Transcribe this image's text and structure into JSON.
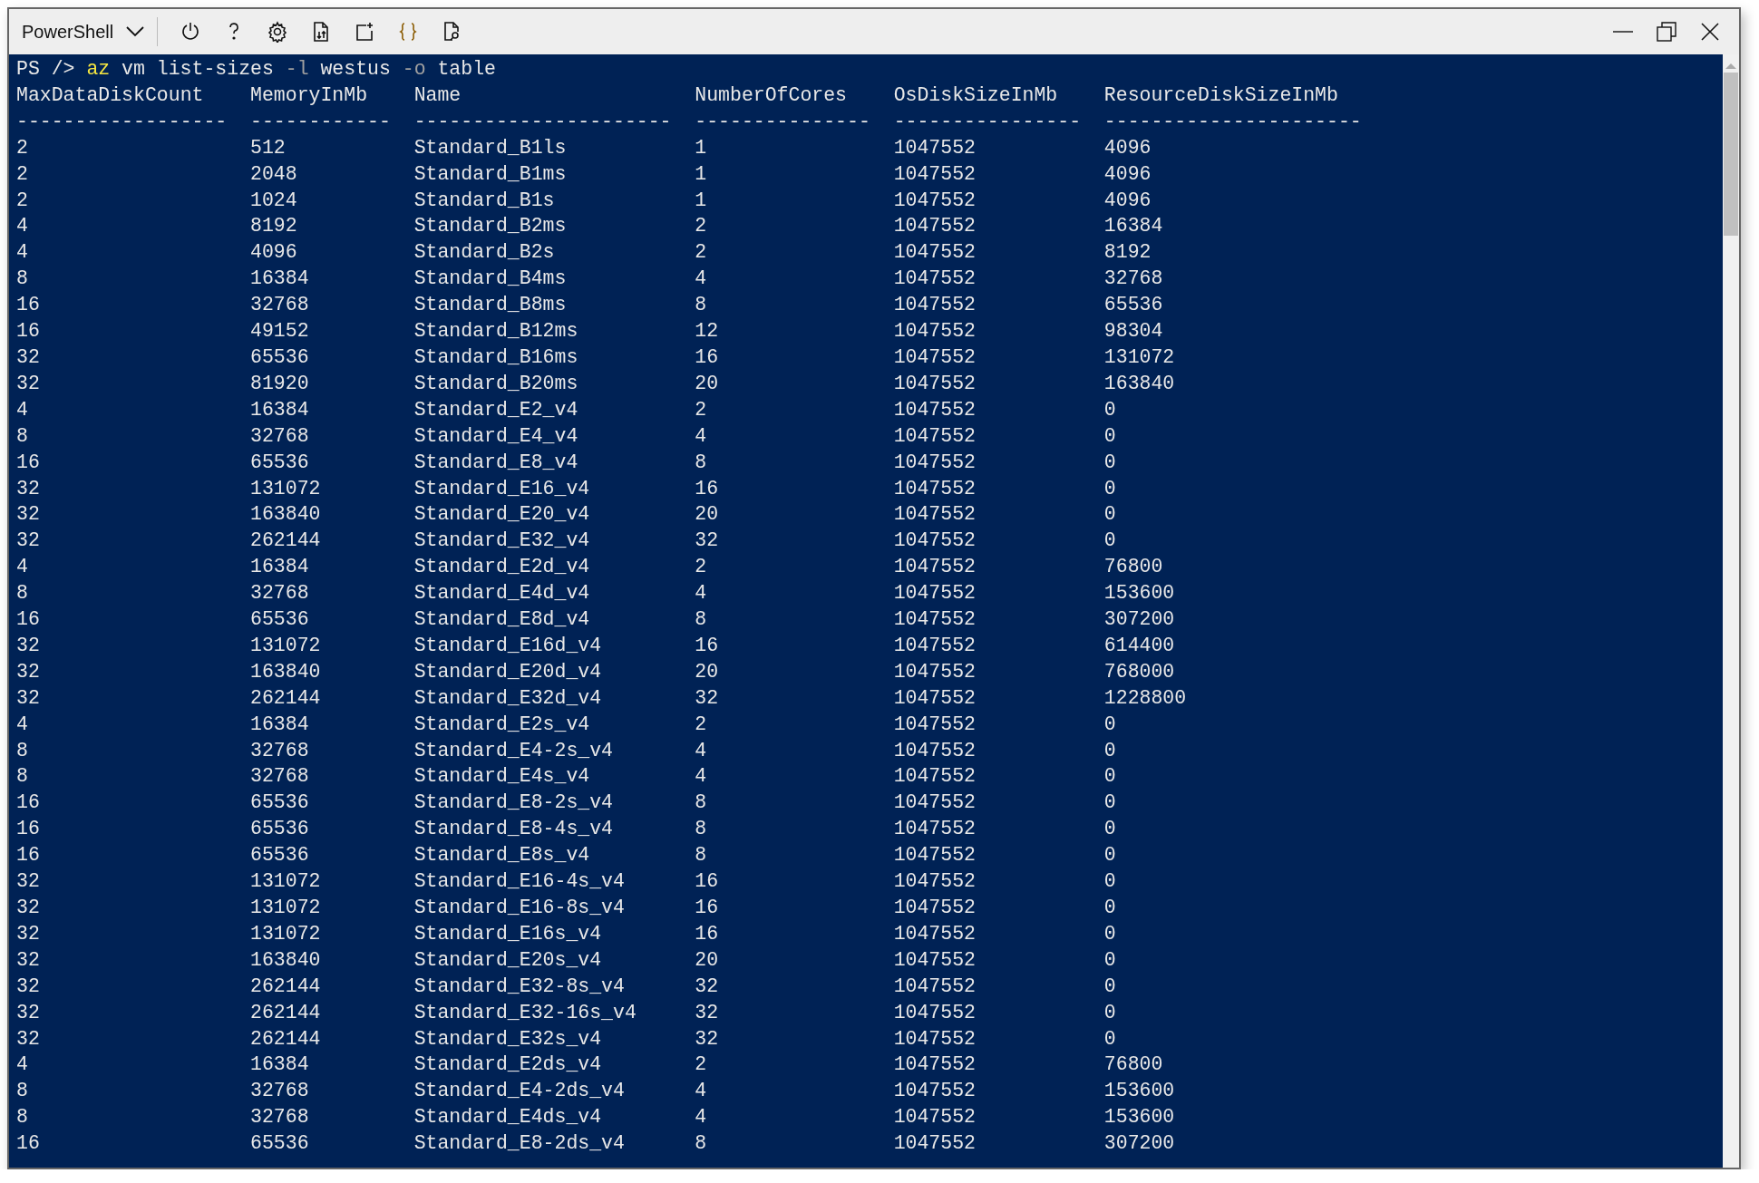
{
  "toolbar": {
    "shell_selector": "PowerShell",
    "buttons": [
      {
        "kind": "power"
      },
      {
        "kind": "help"
      },
      {
        "kind": "settings"
      },
      {
        "kind": "upload"
      },
      {
        "kind": "new-session"
      },
      {
        "kind": "editor"
      },
      {
        "kind": "web-preview"
      }
    ]
  },
  "terminal": {
    "prompt": "PS />",
    "command": [
      {
        "kind": "command",
        "text": "az"
      },
      {
        "kind": "argument",
        "text": "vm"
      },
      {
        "kind": "argument",
        "text": "list-sizes"
      },
      {
        "kind": "parameter",
        "text": "-l"
      },
      {
        "kind": "argument",
        "text": "westus"
      },
      {
        "kind": "parameter",
        "text": "-o"
      },
      {
        "kind": "argument",
        "text": "table"
      }
    ],
    "columns": [
      {
        "heading": "MaxDataDiskCount",
        "rule": "------------------"
      },
      {
        "heading": "MemoryInMb",
        "rule": "------------"
      },
      {
        "heading": "Name",
        "rule": "----------------------"
      },
      {
        "heading": "NumberOfCores",
        "rule": "---------------"
      },
      {
        "heading": "OsDiskSizeInMb",
        "rule": "----------------"
      },
      {
        "heading": "ResourceDiskSizeInMb",
        "rule": "----------------------"
      }
    ],
    "rows": [
      [
        "2",
        "512",
        "Standard_B1ls",
        "1",
        "1047552",
        "4096"
      ],
      [
        "2",
        "2048",
        "Standard_B1ms",
        "1",
        "1047552",
        "4096"
      ],
      [
        "2",
        "1024",
        "Standard_B1s",
        "1",
        "1047552",
        "4096"
      ],
      [
        "4",
        "8192",
        "Standard_B2ms",
        "2",
        "1047552",
        "16384"
      ],
      [
        "4",
        "4096",
        "Standard_B2s",
        "2",
        "1047552",
        "8192"
      ],
      [
        "8",
        "16384",
        "Standard_B4ms",
        "4",
        "1047552",
        "32768"
      ],
      [
        "16",
        "32768",
        "Standard_B8ms",
        "8",
        "1047552",
        "65536"
      ],
      [
        "16",
        "49152",
        "Standard_B12ms",
        "12",
        "1047552",
        "98304"
      ],
      [
        "32",
        "65536",
        "Standard_B16ms",
        "16",
        "1047552",
        "131072"
      ],
      [
        "32",
        "81920",
        "Standard_B20ms",
        "20",
        "1047552",
        "163840"
      ],
      [
        "4",
        "16384",
        "Standard_E2_v4",
        "2",
        "1047552",
        "0"
      ],
      [
        "8",
        "32768",
        "Standard_E4_v4",
        "4",
        "1047552",
        "0"
      ],
      [
        "16",
        "65536",
        "Standard_E8_v4",
        "8",
        "1047552",
        "0"
      ],
      [
        "32",
        "131072",
        "Standard_E16_v4",
        "16",
        "1047552",
        "0"
      ],
      [
        "32",
        "163840",
        "Standard_E20_v4",
        "20",
        "1047552",
        "0"
      ],
      [
        "32",
        "262144",
        "Standard_E32_v4",
        "32",
        "1047552",
        "0"
      ],
      [
        "4",
        "16384",
        "Standard_E2d_v4",
        "2",
        "1047552",
        "76800"
      ],
      [
        "8",
        "32768",
        "Standard_E4d_v4",
        "4",
        "1047552",
        "153600"
      ],
      [
        "16",
        "65536",
        "Standard_E8d_v4",
        "8",
        "1047552",
        "307200"
      ],
      [
        "32",
        "131072",
        "Standard_E16d_v4",
        "16",
        "1047552",
        "614400"
      ],
      [
        "32",
        "163840",
        "Standard_E20d_v4",
        "20",
        "1047552",
        "768000"
      ],
      [
        "32",
        "262144",
        "Standard_E32d_v4",
        "32",
        "1047552",
        "1228800"
      ],
      [
        "4",
        "16384",
        "Standard_E2s_v4",
        "2",
        "1047552",
        "0"
      ],
      [
        "8",
        "32768",
        "Standard_E4-2s_v4",
        "4",
        "1047552",
        "0"
      ],
      [
        "8",
        "32768",
        "Standard_E4s_v4",
        "4",
        "1047552",
        "0"
      ],
      [
        "16",
        "65536",
        "Standard_E8-2s_v4",
        "8",
        "1047552",
        "0"
      ],
      [
        "16",
        "65536",
        "Standard_E8-4s_v4",
        "8",
        "1047552",
        "0"
      ],
      [
        "16",
        "65536",
        "Standard_E8s_v4",
        "8",
        "1047552",
        "0"
      ],
      [
        "32",
        "131072",
        "Standard_E16-4s_v4",
        "16",
        "1047552",
        "0"
      ],
      [
        "32",
        "131072",
        "Standard_E16-8s_v4",
        "16",
        "1047552",
        "0"
      ],
      [
        "32",
        "131072",
        "Standard_E16s_v4",
        "16",
        "1047552",
        "0"
      ],
      [
        "32",
        "163840",
        "Standard_E20s_v4",
        "20",
        "1047552",
        "0"
      ],
      [
        "32",
        "262144",
        "Standard_E32-8s_v4",
        "32",
        "1047552",
        "0"
      ],
      [
        "32",
        "262144",
        "Standard_E32-16s_v4",
        "32",
        "1047552",
        "0"
      ],
      [
        "32",
        "262144",
        "Standard_E32s_v4",
        "32",
        "1047552",
        "0"
      ],
      [
        "4",
        "16384",
        "Standard_E2ds_v4",
        "2",
        "1047552",
        "76800"
      ],
      [
        "8",
        "32768",
        "Standard_E4-2ds_v4",
        "4",
        "1047552",
        "153600"
      ],
      [
        "8",
        "32768",
        "Standard_E4ds_v4",
        "4",
        "1047552",
        "153600"
      ],
      [
        "16",
        "65536",
        "Standard_E8-2ds_v4",
        "8",
        "1047552",
        "307200"
      ]
    ]
  }
}
